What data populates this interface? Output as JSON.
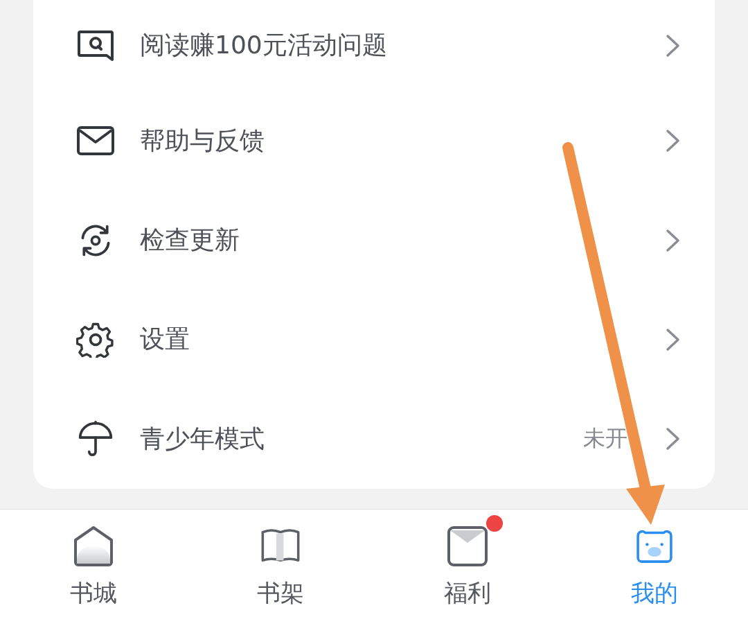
{
  "menu": [
    {
      "label": "阅读赚100元活动问题"
    },
    {
      "label": "帮助与反馈"
    },
    {
      "label": "检查更新"
    },
    {
      "label": "设置"
    },
    {
      "label": "青少年模式",
      "value": "未开"
    }
  ],
  "tab_bar": [
    {
      "label": "书城",
      "selected": false,
      "dot": false
    },
    {
      "label": "书架",
      "selected": false,
      "dot": false
    },
    {
      "label": "福利",
      "selected": false,
      "dot": true
    },
    {
      "label": "我的",
      "selected": true,
      "dot": false
    }
  ]
}
